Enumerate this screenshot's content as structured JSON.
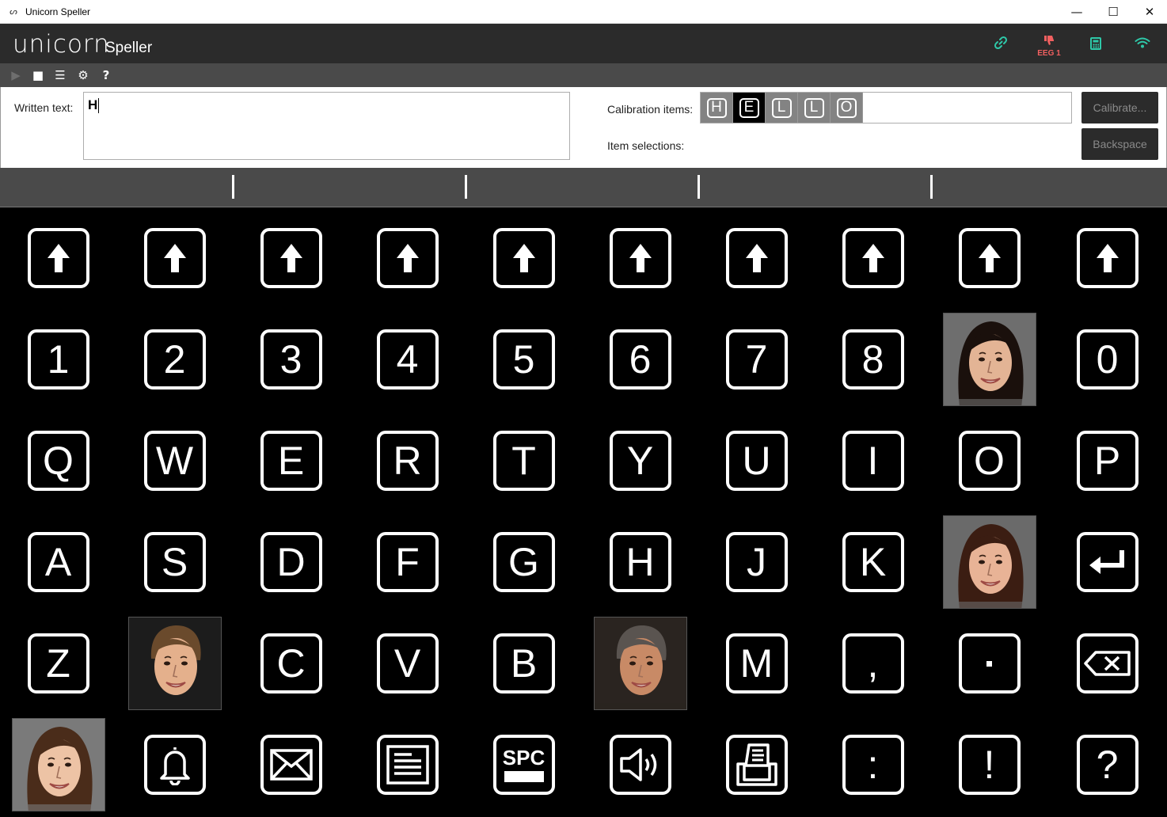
{
  "window": {
    "title": "Unicorn Speller",
    "minimize": "—",
    "maximize": "☐",
    "close": "✕"
  },
  "header": {
    "logo": "unicorn",
    "subtitle": "Speller",
    "icons": {
      "link": "link-icon",
      "eeg": "thumbs-down-icon",
      "calculator": "calculator-icon",
      "wifi": "wifi-icon"
    },
    "eeg_label": "EEG 1",
    "accent_color": "#2ec8a8",
    "eeg_color": "#f26060"
  },
  "toolbar": {
    "play": "▶",
    "stop": "■",
    "list": "☰",
    "settings": "⚙",
    "help": "?"
  },
  "panel": {
    "written_label": "Written text:",
    "written_value": "H",
    "calibration_label": "Calibration items:",
    "calibration_items": [
      "H",
      "E",
      "L",
      "L",
      "O"
    ],
    "calibration_active_index": 1,
    "selections_label": "Item selections:",
    "calibrate_button": "Calibrate...",
    "backspace_button": "Backspace"
  },
  "grid": {
    "rows": [
      [
        "shift-up",
        "shift-up",
        "shift-up",
        "shift-up",
        "shift-up",
        "shift-up",
        "shift-up",
        "shift-up",
        "shift-up",
        "shift-up"
      ],
      [
        "1",
        "2",
        "3",
        "4",
        "5",
        "6",
        "7",
        "8",
        "face",
        "0"
      ],
      [
        "Q",
        "W",
        "E",
        "R",
        "T",
        "Y",
        "U",
        "I",
        "O",
        "P"
      ],
      [
        "A",
        "S",
        "D",
        "F",
        "G",
        "H",
        "J",
        "K",
        "face",
        "enter"
      ],
      [
        "Z",
        "face",
        "C",
        "V",
        "B",
        "face",
        "M",
        ",",
        "·",
        "backspace"
      ],
      [
        "face",
        "bell",
        "mail",
        "document",
        "SPC",
        "speaker",
        "printer",
        ":",
        "!",
        "?"
      ]
    ]
  }
}
